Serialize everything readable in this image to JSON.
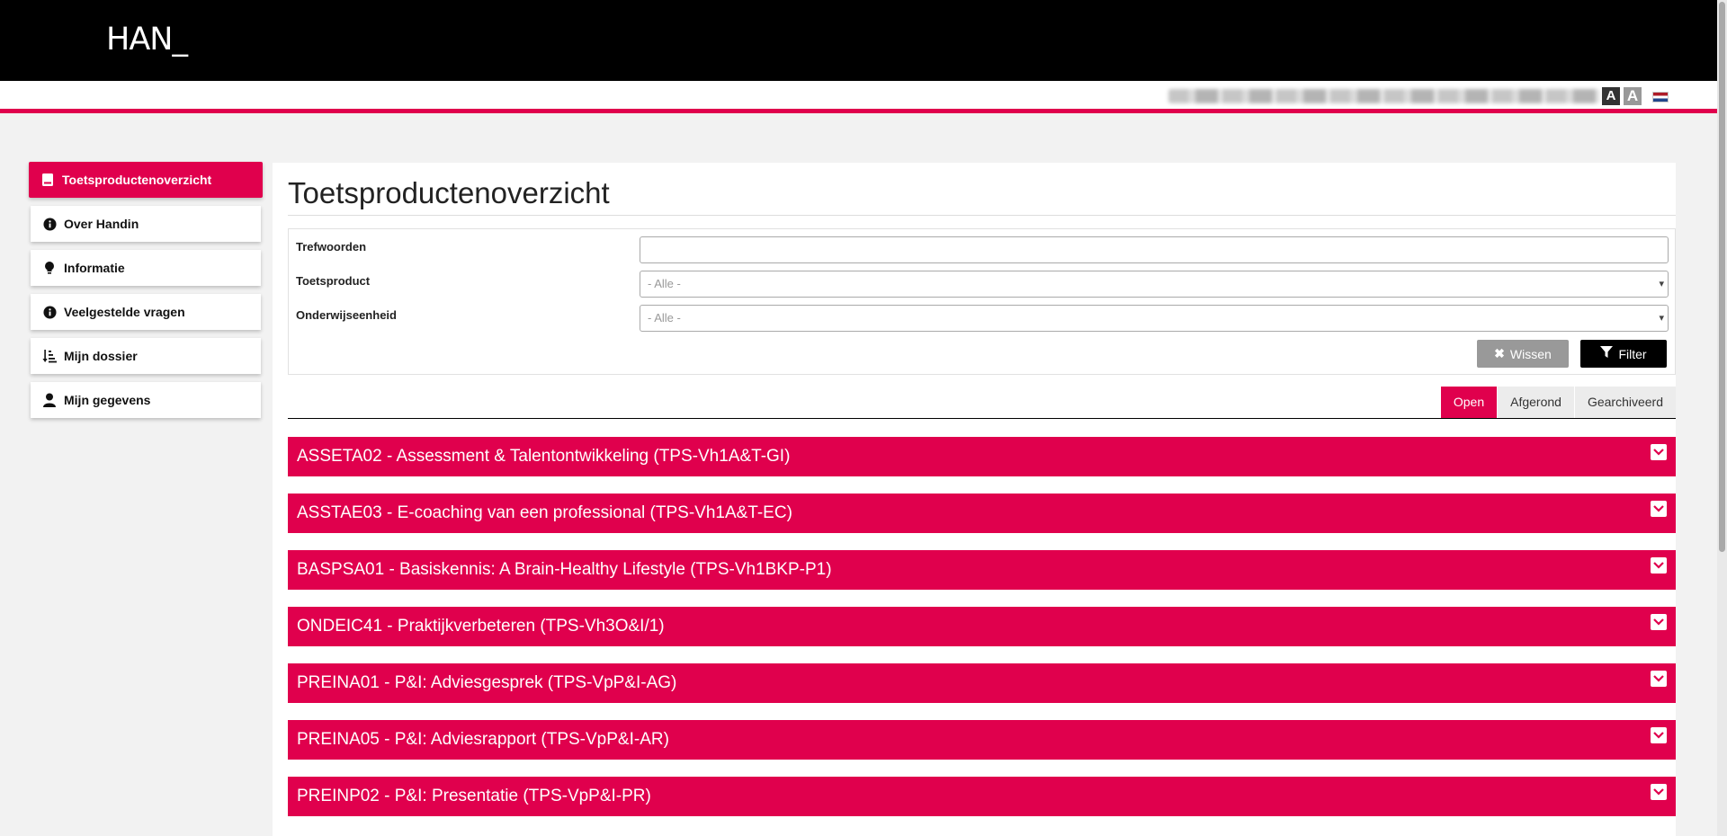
{
  "brand": {
    "logo": "HAN_",
    "accent": "#e0004d"
  },
  "header": {
    "font_small": "A",
    "font_large": "A",
    "language_flag": "dutch-flag-icon"
  },
  "sidebar": {
    "items": [
      {
        "label": "Toetsproductenoverzicht",
        "icon": "book-icon",
        "active": true
      },
      {
        "label": "Over Handin",
        "icon": "info-icon"
      },
      {
        "label": "Informatie",
        "icon": "lightbulb-icon"
      },
      {
        "label": "Veelgestelde vragen",
        "icon": "info-icon"
      },
      {
        "label": "Mijn dossier",
        "icon": "sort-list-icon"
      },
      {
        "label": "Mijn gegevens",
        "icon": "user-icon"
      }
    ]
  },
  "main": {
    "title": "Toetsproductenoverzicht",
    "filters": {
      "keywords_label": "Trefwoorden",
      "keywords_value": "",
      "product_label": "Toetsproduct",
      "product_value": "- Alle -",
      "unit_label": "Onderwijseenheid",
      "unit_value": "- Alle -",
      "clear_label": "Wissen",
      "filter_label": "Filter"
    },
    "tabs": [
      {
        "label": "Open",
        "active": true
      },
      {
        "label": "Afgerond"
      },
      {
        "label": "Gearchiveerd"
      }
    ],
    "products": [
      "ASSETA02 - Assessment & Talentontwikkeling (TPS-Vh1A&T-GI)",
      "ASSTAE03 - E-coaching van een professional (TPS-Vh1A&T-EC)",
      "BASPSA01 - Basiskennis: A Brain-Healthy Lifestyle (TPS-Vh1BKP-P1)",
      "ONDEIC41 - Praktijkverbeteren (TPS-Vh3O&I/1)",
      "PREINA01 - P&I: Adviesgesprek (TPS-VpP&I-AG)",
      "PREINA05 - P&I: Adviesrapport (TPS-VpP&I-AR)",
      "PREINP02 - P&I: Presentatie (TPS-VpP&I-PR)"
    ]
  }
}
